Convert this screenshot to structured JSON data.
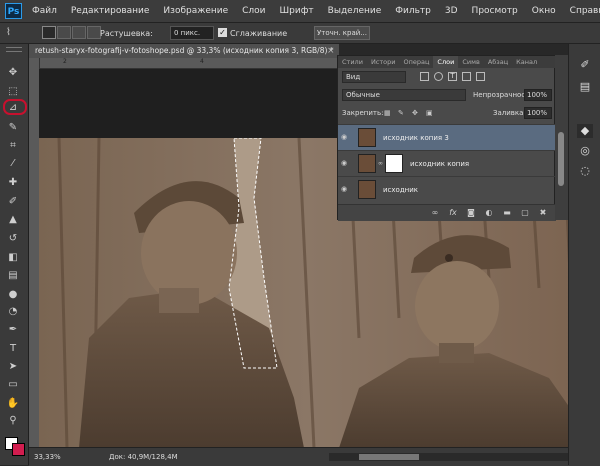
{
  "menu": [
    "Файл",
    "Редактирование",
    "Изображение",
    "Слои",
    "Шрифт",
    "Выделение",
    "Фильтр",
    "3D",
    "Просмотр",
    "Окно",
    "Справка"
  ],
  "options": {
    "feather_label": "Растушевка:",
    "feather_value": "0 пикс.",
    "antialias_checked": true,
    "antialias_label": "Сглаживание",
    "refine_button": "Уточн. край..."
  },
  "tools": [
    "move-icon",
    "marquee-icon",
    "polygonal-lasso-icon",
    "quick-selection-icon",
    "crop-icon",
    "eyedropper-icon",
    "spot-healing-icon",
    "brush-icon",
    "clone-stamp-icon",
    "history-brush-icon",
    "eraser-icon",
    "gradient-icon",
    "blur-icon",
    "dodge-icon",
    "pen-icon",
    "type-icon",
    "path-selection-icon",
    "rectangle-icon",
    "hand-icon",
    "zoom-icon"
  ],
  "colors": {
    "foreground": "#ffffff",
    "background": "#d21d4f",
    "highlight": "#c8102e"
  },
  "document": {
    "tab_title": "retush-staryx-fotografij-v-fotoshope.psd @ 33,3% (исходник копия 3, RGB/8) *",
    "zoom": "33,33%",
    "doc_size": "Док: 40,9М/128,4М"
  },
  "layers_panel": {
    "tabs": [
      "Стили",
      "Истори",
      "Операц",
      "Слои",
      "Симв",
      "Абзац",
      "Канал"
    ],
    "active_tab": "Слои",
    "kind": "Вид",
    "blend_mode": "Обычные",
    "opacity_label": "Непрозрачность:",
    "opacity_value": "100%",
    "lock_label": "Закрепить:",
    "fill_label": "Заливка:",
    "fill_value": "100%",
    "layers": [
      {
        "name": "исходник копия 3",
        "selected": true,
        "mask": false
      },
      {
        "name": "исходник копия",
        "selected": false,
        "mask": true
      },
      {
        "name": "исходник",
        "selected": false,
        "mask": false
      }
    ]
  }
}
